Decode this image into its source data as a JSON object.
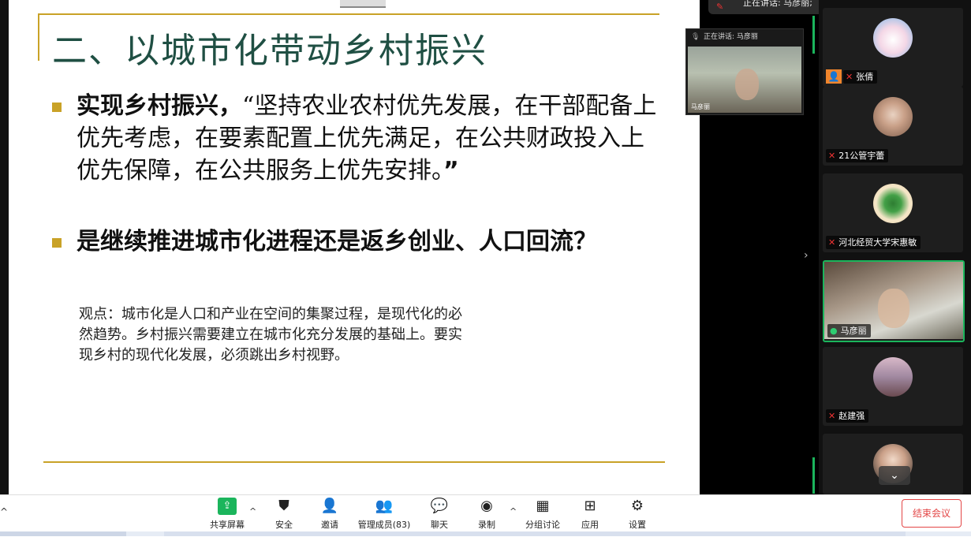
{
  "slide": {
    "title": "二、以城市化带动乡村振兴",
    "bullet1_bold": "实现乡村振兴，",
    "bullet1_rest": "“坚持农业农村优先发展，在干部配备上优先考虑，在要素配置上优先满足，在公共财政投入上优先保障，在公共服务上优先安排。",
    "bullet1_close": "”",
    "bullet2": "是继续推进城市化进程还是返乡创业、人口回流？",
    "note": "观点：城市化是人口和产业在空间的集聚过程，是现代化的必然趋势。乡村振兴需要建立在城市化充分发展的基础上。要实现乡村的现代化发展，必须跳出乡村视野。"
  },
  "speaker_bar": {
    "text": "正在讲话: 马彦丽;"
  },
  "mini_video": {
    "header": "正在讲话: 马彦丽",
    "name": "马彦丽"
  },
  "participants": [
    {
      "name": "张倩",
      "mic": "off"
    },
    {
      "name": "21公管宇蕾",
      "mic": "off"
    },
    {
      "name": "河北经贸大学宋惠敏",
      "mic": "off"
    },
    {
      "name": "马彦丽",
      "mic": "on",
      "active": true
    },
    {
      "name": "赵建强",
      "mic": "off"
    },
    {
      "name": "",
      "mic": "off"
    }
  ],
  "toolbar": {
    "share": "共享屏幕",
    "security": "安全",
    "invite": "邀请",
    "manage": "管理成员(83)",
    "chat": "聊天",
    "record": "录制",
    "breakout": "分组讨论",
    "apps": "应用",
    "settings": "设置",
    "end": "结束会议"
  },
  "colors": {
    "accent": "#1bb55c",
    "gold": "#c9a227",
    "title": "#1f4f43",
    "end": "#e34646"
  },
  "icons": {
    "share": "share-screen-icon",
    "security": "shield-icon",
    "invite": "add-user-icon",
    "manage": "users-icon",
    "chat": "chat-icon",
    "record": "record-icon",
    "breakout": "breakout-icon",
    "apps": "apps-icon",
    "settings": "gear-icon"
  }
}
